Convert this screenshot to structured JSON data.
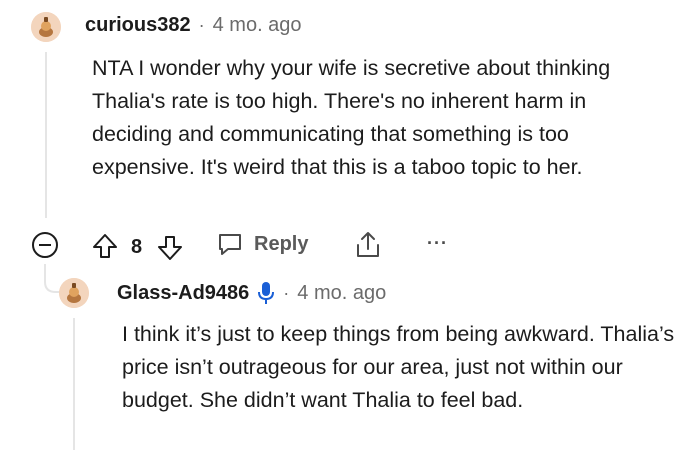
{
  "comments": [
    {
      "username": "curious382",
      "separator": "·",
      "time": "4 mo. ago",
      "body": "NTA I wonder why your wife is secretive about thinking Thalia's rate is too high. There's no inherent harm in deciding and communicating that something is too expensive. It's weird that this is a taboo topic to her.",
      "actions": {
        "vote_count": "8",
        "reply_label": "Reply",
        "more_label": "···"
      }
    },
    {
      "username": "Glass-Ad9486",
      "separator": "·",
      "time": "4 mo. ago",
      "body": "I think it’s just to keep things from being awkward. Thalia’s price isn’t outrageous for our area, just not within our budget. She didn’t want Thalia to feel bad."
    }
  ],
  "icons": {
    "collapse": "minus-circle-icon",
    "upvote": "arrow-up-icon",
    "downvote": "arrow-down-icon",
    "reply": "speech-bubble-icon",
    "share": "share-icon",
    "mic": "microphone-icon",
    "avatar": "avatar-icon"
  },
  "colors": {
    "mic": "#1a5fd6",
    "avatar_bg": "#f3d5bd",
    "thread_line": "#e5e5e5",
    "meta_text": "#6b6b6b"
  }
}
